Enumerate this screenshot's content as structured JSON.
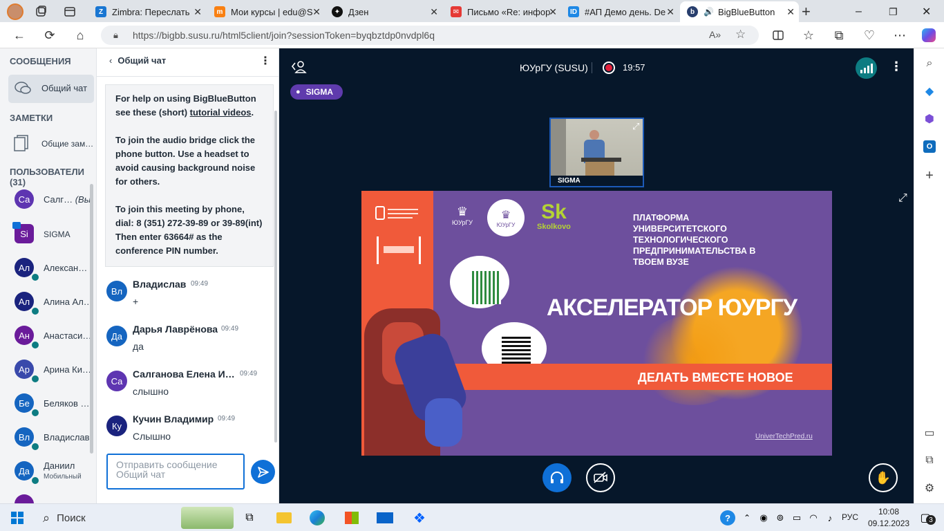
{
  "tabs": [
    {
      "label": "",
      "icon": "profile-avatar-icon"
    },
    {
      "label": "",
      "icon": "collections-icon"
    },
    {
      "label": "",
      "icon": "tab-actions-icon"
    },
    {
      "label": "Zimbra: Переслать",
      "icon": "zimbra-icon"
    },
    {
      "label": "Мои курсы | edu@S",
      "icon": "moodle-icon"
    },
    {
      "label": "Дзен",
      "icon": "dzen-icon"
    },
    {
      "label": "Письмо «Re: инфор",
      "icon": "mail-icon"
    },
    {
      "label": "#АП Демо день. De",
      "icon": "id-icon"
    },
    {
      "label": "BigBlueButton",
      "icon": "bbb-icon"
    }
  ],
  "address": {
    "url": "https://bigbb.susu.ru/html5client/join?sessionToken=byqbztdp0nvdpl6q"
  },
  "left": {
    "messages_header": "СООБЩЕНИЯ",
    "public_chat": "Общий чат",
    "notes_header": "ЗАМЕТКИ",
    "shared_notes": "Общие зам…",
    "users_header": "ПОЛЬЗОВАТЕЛИ (31)",
    "users": [
      {
        "initials": "Са",
        "name": "Салг…",
        "you": "(Вы)",
        "color": "#5e35b1"
      },
      {
        "initials": "Si",
        "name": "SIGMA",
        "color": "#6a1b9a"
      },
      {
        "initials": "Ал",
        "name": "Алексан…",
        "color": "#1a237e"
      },
      {
        "initials": "Ал",
        "name": "Алина Ал…",
        "color": "#1a237e"
      },
      {
        "initials": "Ан",
        "name": "Анастаси…",
        "color": "#6a1b9a"
      },
      {
        "initials": "Ар",
        "name": "Арина Ки…",
        "color": "#3949ab"
      },
      {
        "initials": "Бе",
        "name": "Беляков …",
        "color": "#1565c0"
      },
      {
        "initials": "Вл",
        "name": "Владислав",
        "color": "#1565c0"
      },
      {
        "initials": "Да",
        "name": "Даниил",
        "sub": "Мобильный",
        "color": "#1565c0"
      }
    ]
  },
  "chat": {
    "title": "Общий чат",
    "welcome": {
      "p1a": "For help on using BigBlueButton see these (short) ",
      "p1link": "tutorial videos",
      "p1b": ".",
      "p2": "To join the audio bridge click the phone button. Use a headset to avoid causing background noise for others.",
      "p3": "To join this meeting by phone, dial: 8 (351) 272-39-89 or 39-89(int) Then enter 63664# as the conference PIN number."
    },
    "messages": [
      {
        "initials": "Вл",
        "name": "Владислав",
        "time": "09:49",
        "text": "+",
        "color": "#1565c0"
      },
      {
        "initials": "Да",
        "name": "Дарья Лаврёнова",
        "time": "09:49",
        "text": "да",
        "color": "#1565c0"
      },
      {
        "initials": "Са",
        "name": "Салганова Елена И…",
        "time": "09:49",
        "text": "слышно",
        "color": "#5e35b1"
      },
      {
        "initials": "Ку",
        "name": "Кучин Владимир",
        "time": "09:49",
        "text": "Слышно",
        "color": "#1a237e"
      }
    ],
    "input_placeholder": "Отправить сообщение Общий чат"
  },
  "main": {
    "meeting_title": "ЮУрГУ (SUSU)",
    "timer": "19:57",
    "presenter_badge": "SIGMA",
    "cam_label": "SIGMA",
    "slide": {
      "logo1": "ЮУрГУ",
      "logo2": "ЮУрГУ",
      "logo3": "Skolkovo",
      "heading": "ПЛАТФОРМА УНИВЕРСИТЕТСКОГО ТЕХНОЛОГИЧЕСКОГО ПРЕДПРИНИМАТЕЛЬСТВА В ТВОЕМ ВУЗЕ",
      "big": "АКСЕЛЕРАТОР ЮУРГУ",
      "banner": "ДЕЛАТЬ ВМЕСТЕ НОВОЕ",
      "site": "UniverTechPred.ru"
    }
  },
  "taskbar": {
    "search": "Поиск",
    "lang": "РУС",
    "time": "10:08",
    "date": "09.12.2023",
    "notif_count": "3"
  },
  "colors": {
    "accent": "#0f70d7",
    "main_bg": "#06172a",
    "purple": "#5f3bad",
    "slide_orange": "#f26b3a"
  }
}
